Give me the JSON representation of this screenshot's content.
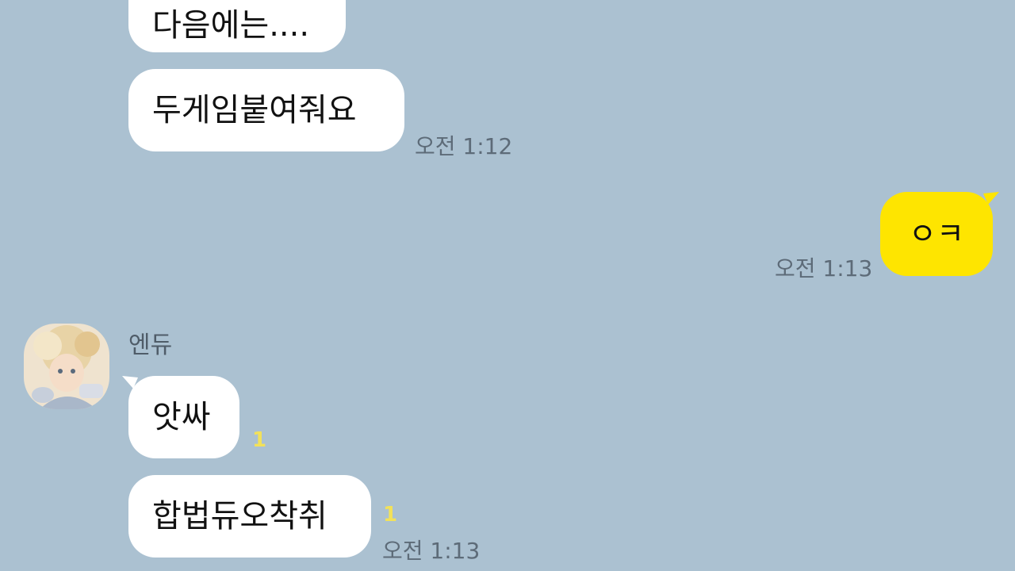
{
  "colors": {
    "background": "#abc1d1",
    "incoming_bubble": "#ffffff",
    "outgoing_bubble": "#fee500",
    "timestamp": "#5d6b78",
    "unread_count": "#f2e15a"
  },
  "messages": [
    {
      "text": "다음에는....",
      "direction": "incoming"
    },
    {
      "text": "두게임붙여줘요",
      "direction": "incoming",
      "time": "오전 1:12"
    },
    {
      "text": "ㅇㅋ",
      "direction": "outgoing",
      "time": "오전 1:13"
    },
    {
      "sender": "엔듀",
      "avatar_icon": "profile-avatar-icon",
      "text": "앗싸",
      "direction": "incoming",
      "unread": "1"
    },
    {
      "text": "합법듀오착취",
      "direction": "incoming",
      "unread": "1",
      "time": "오전 1:13"
    }
  ]
}
